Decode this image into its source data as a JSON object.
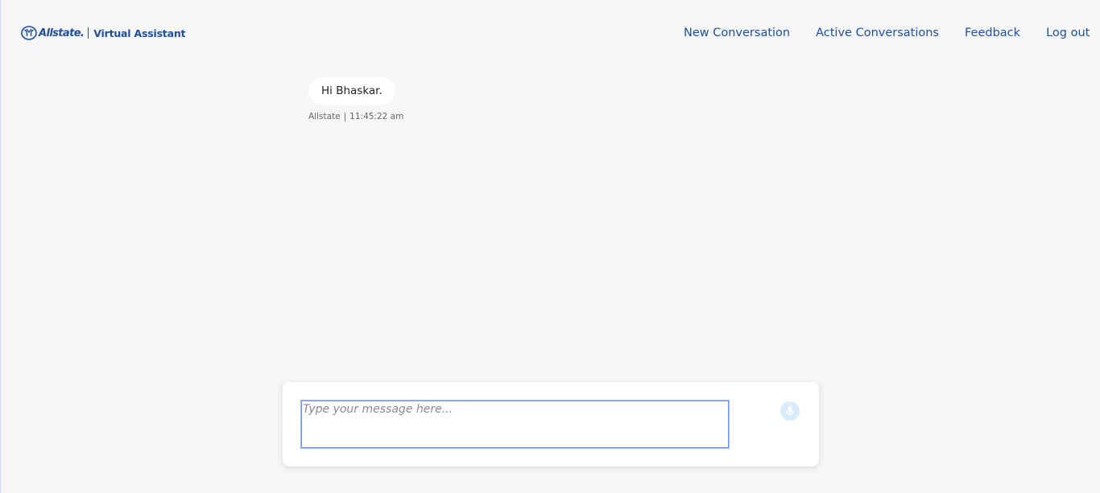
{
  "header": {
    "brand": "Allstate.",
    "product": "Virtual Assistant",
    "nav": [
      {
        "label": "New Conversation"
      },
      {
        "label": "Active Conversations"
      },
      {
        "label": "Feedback"
      },
      {
        "label": "Log out"
      }
    ]
  },
  "conversation": {
    "messages": [
      {
        "text": "Hi Bhaskar.",
        "sender": "Allstate",
        "separator": "|",
        "time": "11:45:22 am"
      }
    ]
  },
  "composer": {
    "value": "",
    "placeholder": "Type your message here...",
    "mic_icon": "microphone-icon"
  },
  "colors": {
    "brand": "#1d4f9e",
    "background": "#f6f6f6",
    "input_focus": "#6f9ae6",
    "mic_bg": "#d7ecf8"
  }
}
